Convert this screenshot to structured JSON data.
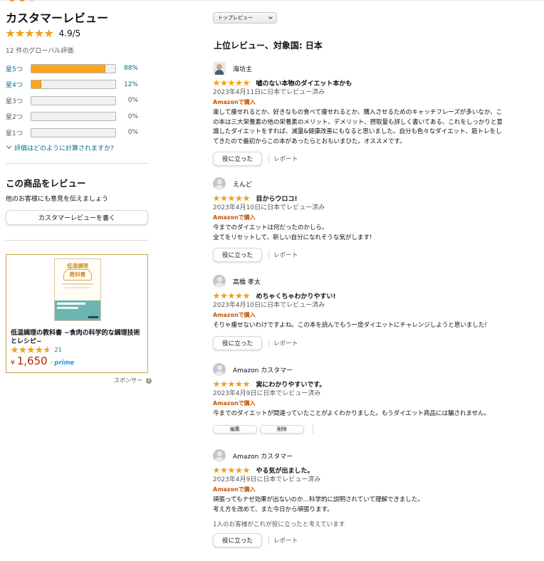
{
  "summary": {
    "title": "カスタマーレビュー",
    "average_rating": 4.9,
    "average_text": "4.9/5",
    "global_count": "12 件のグローバル評価",
    "histogram": [
      {
        "label": "星5つ",
        "percent": 88,
        "percent_text": "88%",
        "active": true
      },
      {
        "label": "星4つ",
        "percent": 12,
        "percent_text": "12%",
        "active": true
      },
      {
        "label": "星3つ",
        "percent": 0,
        "percent_text": "0%",
        "active": false
      },
      {
        "label": "星2つ",
        "percent": 0,
        "percent_text": "0%",
        "active": false
      },
      {
        "label": "星1つ",
        "percent": 0,
        "percent_text": "0%",
        "active": false
      }
    ],
    "how_calculated": "評価はどのように計算されますか?"
  },
  "write_review": {
    "title": "この商品をレビュー",
    "subtitle": "他のお客様にも意見を伝えましょう",
    "button": "カスタマーレビューを書く"
  },
  "ad": {
    "title": "低温調理の教科書 ~食肉の科学的な調理技術とレシピ~",
    "cover_text_line1": "低温調理",
    "cover_text_line2": "教科書",
    "rating": 4,
    "rating_count": "21",
    "currency": "¥",
    "price": "1,650",
    "prime_check": "✓",
    "prime_label": "prime",
    "sponsor_label": "スポンサー",
    "info_icon": "i"
  },
  "sort": {
    "selected": "トップレビュー"
  },
  "heading": "上位レビュー、対象国: 日本",
  "reviews": [
    {
      "name": "海坊主",
      "avatar": "photo",
      "rating": 5,
      "title": "嘘のない本物のダイエット本かも",
      "date": "2023年4月11日に日本でレビュー済み",
      "verified": "Amazonで購入",
      "body": "楽して痩せれるとか、好きなもの食べて痩せれるとか、購入させるためのキャッチフレーズが多いなか、こ\nの本は三大栄養素の他の栄養素のメリット、デメリット、摂取量も詳しく書いてある、これをしっかりと意\n識したダイエットをすれば、減量&健康改善にもなると思いました。自分も色々なダイエット、筋トレをし\nてきたので最初からこの本があったらとおもいまひた。オススメです。",
      "helpful": "役に立った",
      "report": "レポート"
    },
    {
      "name": "えんど",
      "avatar": "default",
      "rating": 5,
      "title": "目からウロコ!",
      "date": "2023年4月10日に日本でレビュー済み",
      "verified": "Amazonで購入",
      "body": "今までのダイエットは何だったのかしら。\n全てをリセットして、新しい自分になれそうな気がします!",
      "helpful": "役に立った",
      "report": "レポート"
    },
    {
      "name": "高橋 孝太",
      "avatar": "default",
      "rating": 5,
      "title": "めちゃくちゃわかりやすい!",
      "date": "2023年4月10日に日本でレビュー済み",
      "verified": "Amazonで購入",
      "body": "そりゃ痩せないわけですよね。この本を読んでもう一度ダイエットにチャレンジしようと思いました!",
      "helpful": "役に立った",
      "report": "レポート"
    },
    {
      "name": "Amazon カスタマー",
      "avatar": "default",
      "rating": 5,
      "title": "実にわかりやすいです。",
      "date": "2023年4月9日に日本でレビュー済み",
      "verified": "Amazonで購入",
      "body": "今までのダイエットが間違っていたことがよくわかりました。もうダイエット商品には騙されません。",
      "edit": "編集",
      "delete": "削除"
    },
    {
      "name": "Amazon カスタマー",
      "avatar": "default",
      "rating": 5,
      "title": "やる気が出ました。",
      "date": "2023年4月9日に日本でレビュー済み",
      "verified": "Amazonで購入",
      "body": "頑張ってもナゼ効果が出ないのか…科学的に説明されていて理解できました。\n考え方を改めて、また今日から頑張ります。",
      "helpful_note": "1人のお客様がこれが役に立ったと考えています",
      "helpful": "役に立った",
      "report": "レポート"
    }
  ]
}
